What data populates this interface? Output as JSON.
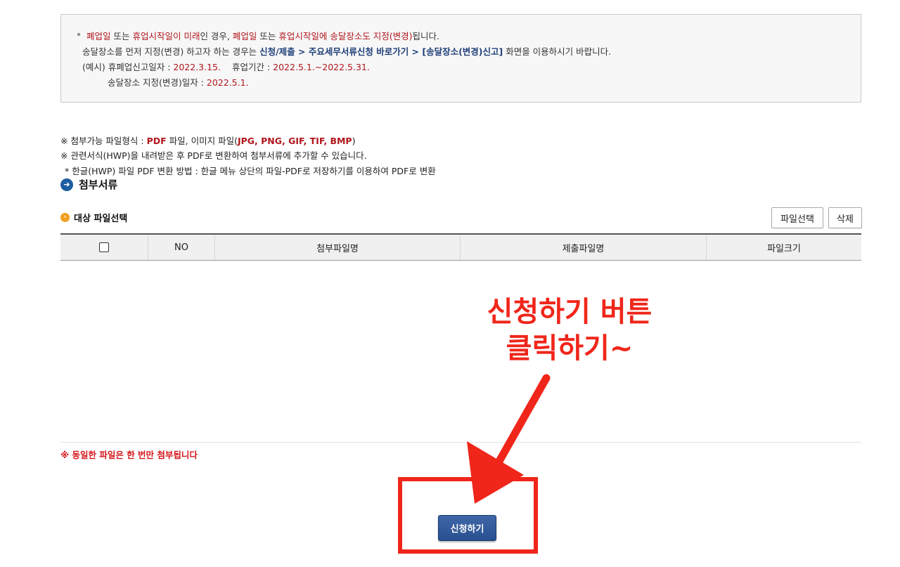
{
  "notice": {
    "line1": {
      "a": "폐업일",
      "b": " 또는 ",
      "c": "휴업시작일이 미래",
      "d": "인 경우, ",
      "e": "폐업일",
      "f": " 또는 ",
      "g": "휴업시작일에 송달장소도 지정(변경)",
      "h": "됩니다."
    },
    "line2": {
      "a": "송달장소를 먼저 지정(변경) 하고자 하는 경우는 ",
      "b": "신청/제출 > 주요세무서류신청 바로가기 > [송달장소(변경)신고]",
      "c": " 화면을 이용하시기 바랍니다."
    },
    "line3": {
      "a": "(예시) 휴폐업신고일자 : ",
      "b": "2022.3.15.",
      "c": "휴업기간 : ",
      "d": "2022.5.1.~2022.5.31."
    },
    "line4": {
      "a": "송달장소 지정(변경)일자 : ",
      "b": "2022.5.1."
    }
  },
  "notes": {
    "n1": {
      "a": "※ 첨부가능 파일형식 : ",
      "b": "PDF",
      "c": " 파일, 이미지 파일(",
      "d": "JPG, PNG, GIF, TIF, BMP",
      "e": ")"
    },
    "n2": "※ 관련서식(HWP)을 내려받은 후 PDF로 변환하여 첨부서류에 추가할 수 있습니다.",
    "n3": "* 한글(HWP) 파일 PDF 변환 방법 : 한글 메뉴 상단의 파일-PDF로 저장하기를 이용하여 PDF로 변환"
  },
  "section": {
    "title": "첨부서류",
    "icon": "arrow-right-circle-icon"
  },
  "file_select": {
    "title": "대상 파일선택",
    "select_button": "파일선택",
    "delete_button": "삭제"
  },
  "table": {
    "columns": [
      "NO",
      "첨부파일명",
      "제출파일명",
      "파일크기"
    ],
    "rows": []
  },
  "warning": "※ 동일한 파일은 한 번만 첨부됩니다",
  "submit_button": "신청하기",
  "annotation": {
    "line1": "신청하기 버튼",
    "line2": "클릭하기~",
    "color": "#f0261a"
  },
  "colors": {
    "highlight_red": "#b1161c",
    "link_blue": "#1f3f78",
    "submit_blue": "#2f5896"
  }
}
